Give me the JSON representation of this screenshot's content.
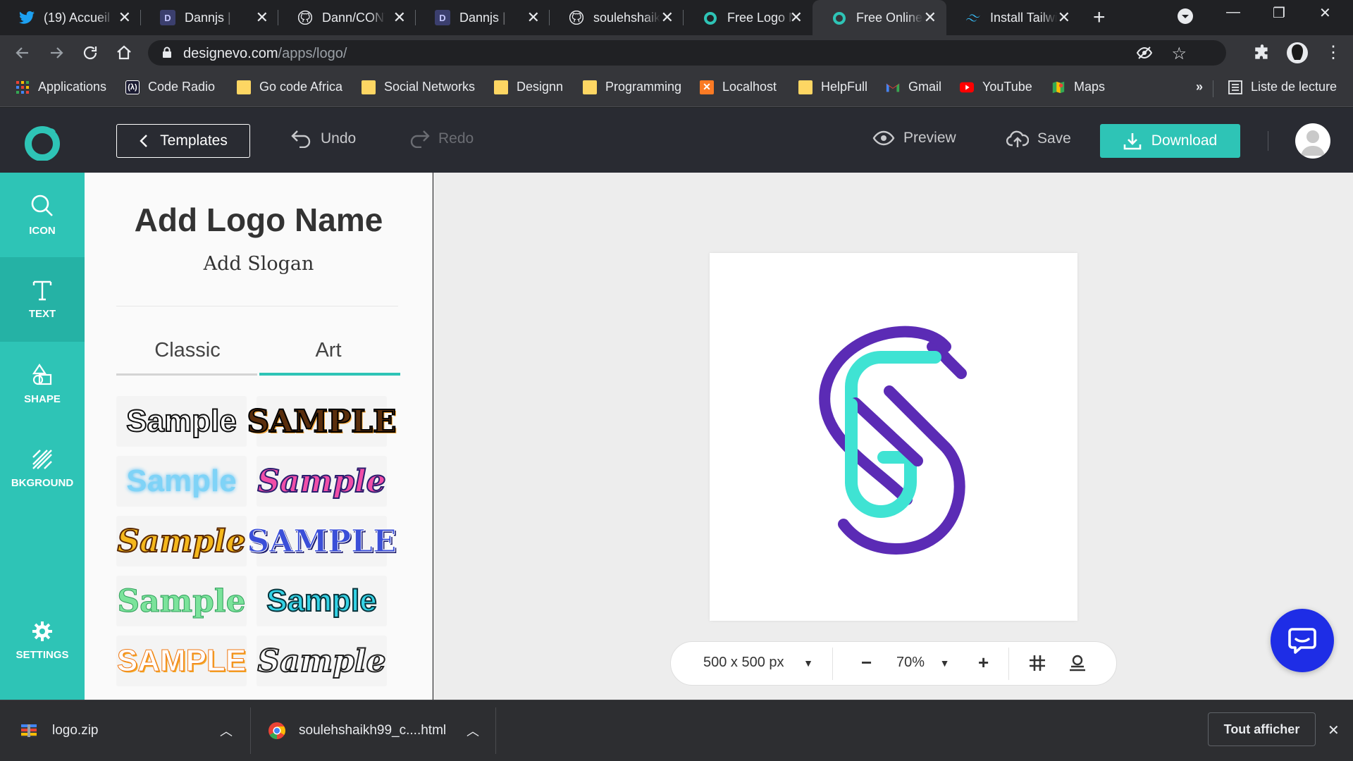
{
  "browser": {
    "tabs": [
      {
        "title": "(19) Accueil",
        "icon": "twitter-icon",
        "color": "#1da1f2"
      },
      {
        "title": "Dannjs | New",
        "icon": "dannjs-icon",
        "color": "#3b3f6e"
      },
      {
        "title": "Dann/CONTRIBUTING",
        "icon": "github-icon",
        "color": "#e8eaed"
      },
      {
        "title": "Dannjs | New",
        "icon": "dannjs-icon",
        "color": "#3b3f6e"
      },
      {
        "title": "soulehshaikh",
        "icon": "github-icon",
        "color": "#e8eaed"
      },
      {
        "title": "Free Logo Maker",
        "icon": "designevo-icon",
        "color": "#2ec4b6"
      },
      {
        "title": "Free Online",
        "icon": "designevo-icon",
        "color": "#2ec4b6"
      },
      {
        "title": "Install Tailwind",
        "icon": "tailwind-icon",
        "color": "#38bdf8"
      }
    ],
    "url_host": "designevo.com",
    "url_path": "/apps/logo/",
    "bookmarks": [
      {
        "label": "Applications",
        "icon": "apps-grid-icon"
      },
      {
        "label": "Code Radio",
        "icon": "code-radio-icon"
      },
      {
        "label": "Go code Africa",
        "icon": "folder-icon"
      },
      {
        "label": "Social Networks",
        "icon": "folder-icon"
      },
      {
        "label": "Designn",
        "icon": "folder-icon"
      },
      {
        "label": "Programming",
        "icon": "folder-icon"
      },
      {
        "label": "Localhost",
        "icon": "xampp-icon"
      },
      {
        "label": "HelpFull",
        "icon": "folder-icon"
      },
      {
        "label": "Gmail",
        "icon": "gmail-icon"
      },
      {
        "label": "YouTube",
        "icon": "youtube-icon"
      },
      {
        "label": "Maps",
        "icon": "maps-icon"
      }
    ],
    "bookmarks_more": "»",
    "reading_list": "Liste de lecture"
  },
  "header": {
    "templates": "Templates",
    "undo": "Undo",
    "redo": "Redo",
    "preview": "Preview",
    "save": "Save",
    "download": "Download"
  },
  "sidebar": {
    "items": [
      {
        "label": "ICON",
        "icon": "search-icon"
      },
      {
        "label": "TEXT",
        "icon": "text-icon"
      },
      {
        "label": "SHAPE",
        "icon": "shape-icon"
      },
      {
        "label": "BKGROUND",
        "icon": "background-icon"
      },
      {
        "label": "SETTINGS",
        "icon": "gear-icon"
      }
    ]
  },
  "panel": {
    "add_name": "Add Logo Name",
    "add_slogan": "Add Slogan",
    "tabs": [
      "Classic",
      "Art"
    ],
    "active_tab": "Art",
    "samples": [
      "Sample",
      "SAMPLE",
      "Sample",
      "Sample",
      "Sample",
      "SAMPLE",
      "Sample",
      "Sample",
      "SAMPLE",
      "Sample"
    ]
  },
  "canvas": {
    "size": "500 x 500 px",
    "zoom": "70%",
    "logo_colors": {
      "purple": "#5b2bb5",
      "teal": "#3fe3d3"
    }
  },
  "downloads": {
    "items": [
      {
        "name": "logo.zip",
        "icon": "zip-file-icon"
      },
      {
        "name": "soulehshaikh99_c....html",
        "icon": "chrome-icon"
      }
    ],
    "show_all": "Tout afficher"
  },
  "colors": {
    "accent": "#2ec4b6",
    "header": "#292b32",
    "chat": "#1e2de6"
  }
}
